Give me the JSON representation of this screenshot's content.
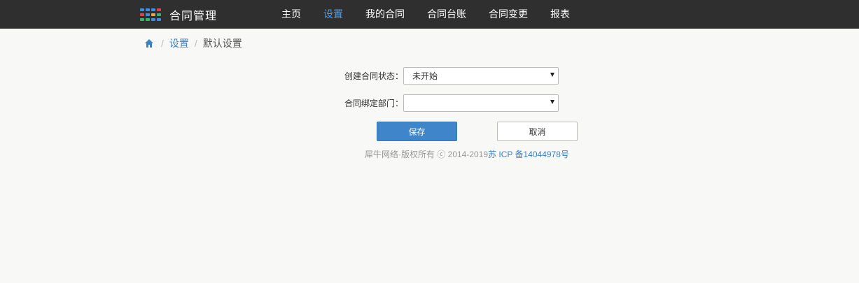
{
  "header": {
    "app_title": "合同管理",
    "logo_colors": [
      "#3a8ee6",
      "#e04343",
      "#3ab36b",
      "#f0a43c"
    ],
    "nav": [
      {
        "label": "主页",
        "active": false
      },
      {
        "label": "设置",
        "active": true
      },
      {
        "label": "我的合同",
        "active": false
      },
      {
        "label": "合同台账",
        "active": false
      },
      {
        "label": "合同变更",
        "active": false
      },
      {
        "label": "报表",
        "active": false
      }
    ],
    "accent_color": "#4a9eed"
  },
  "breadcrumb": {
    "home_icon": "home-icon",
    "items": [
      "设置",
      "默认设置"
    ]
  },
  "form": {
    "status_label": "创建合同状态：",
    "status_value": "未开始",
    "department_label": "合同绑定部门：",
    "department_value": ""
  },
  "buttons": {
    "save": "保存",
    "cancel": "取消"
  },
  "footer": {
    "text": "犀牛网络·版权所有 ⓒ 2014-2019",
    "icp": "苏 ICP 备14044978号"
  }
}
